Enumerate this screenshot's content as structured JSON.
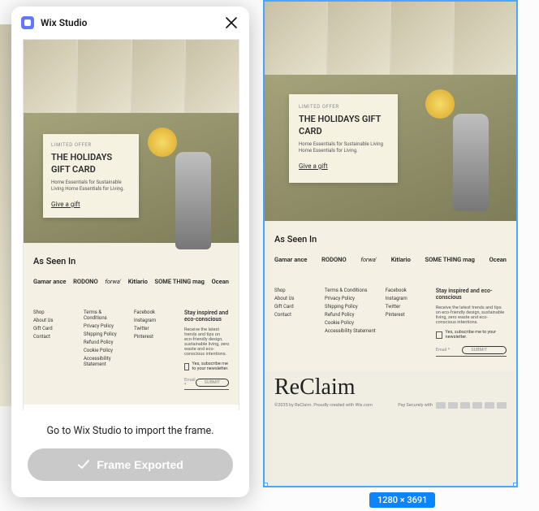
{
  "dialog": {
    "title": "Wix Studio",
    "message": "Go to Wix Studio to import the frame.",
    "cta": "Frame Exported"
  },
  "selection": {
    "size_label": "1280 × 3691"
  },
  "hero_card": {
    "overline": "LIMITED OFFER",
    "heading": "THE HOLIDAYS GIFT CARD",
    "sub": "Home Essentials for Sustainable Living Home Essentials for Living.",
    "link": "Give a gift"
  },
  "as_seen_in": {
    "heading": "As Seen In",
    "logos": [
      "Gamar ance",
      "RODONO",
      "forwa'",
      "Kitlario",
      "SOME THING mag",
      "Ocean"
    ]
  },
  "footer": {
    "col1": [
      "Shop",
      "About Us",
      "Gift Card",
      "Contact"
    ],
    "col2": [
      "Terms & Conditions",
      "Privacy Policy",
      "Shipping Policy",
      "Refund Policy",
      "Cookie Policy",
      "Accessibility Statement"
    ],
    "col3": [
      "Facebook",
      "Instagram",
      "Twitter",
      "Pinterest"
    ]
  },
  "newsletter": {
    "heading": "Stay inspired and eco-conscious",
    "blurb": "Receive the latest trends and tips on eco-friendly design, sustainable living, zero waste and eco-conscious intentions.",
    "checkbox": "Yes, subscribe me to your newsletter.",
    "placeholder": "Email *",
    "submit": "SUBMIT"
  },
  "brand": "ReClaim",
  "credit": {
    "left": "©2035 by ReClaim. Proudly created with Wix.com",
    "pay_label": "Pay Securely with"
  }
}
